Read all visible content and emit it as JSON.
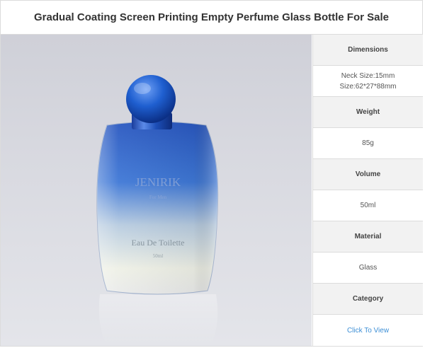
{
  "title": "Gradual Coating Screen Printing Empty Perfume Glass Bottle For Sale",
  "image": {
    "brand_text": "JENIRIK",
    "subline_text": "For Men",
    "product_text": "Eau De Toilette",
    "volume_text": "50ml"
  },
  "specs": [
    {
      "label": "Dimensions",
      "values": [
        "Neck Size:15mm",
        "Size:62*27*88mm"
      ]
    },
    {
      "label": "Weight",
      "values": [
        "85g"
      ]
    },
    {
      "label": "Volume",
      "values": [
        "50ml"
      ]
    },
    {
      "label": "Material",
      "values": [
        "Glass"
      ]
    },
    {
      "label": "Category",
      "values": [
        "Click To View"
      ]
    }
  ],
  "colors": {
    "link": "#3d8fd6",
    "cap": "#1f5fd0",
    "bottle_top": "#2f63c9",
    "bottle_bottom": "#f1f2ec"
  }
}
